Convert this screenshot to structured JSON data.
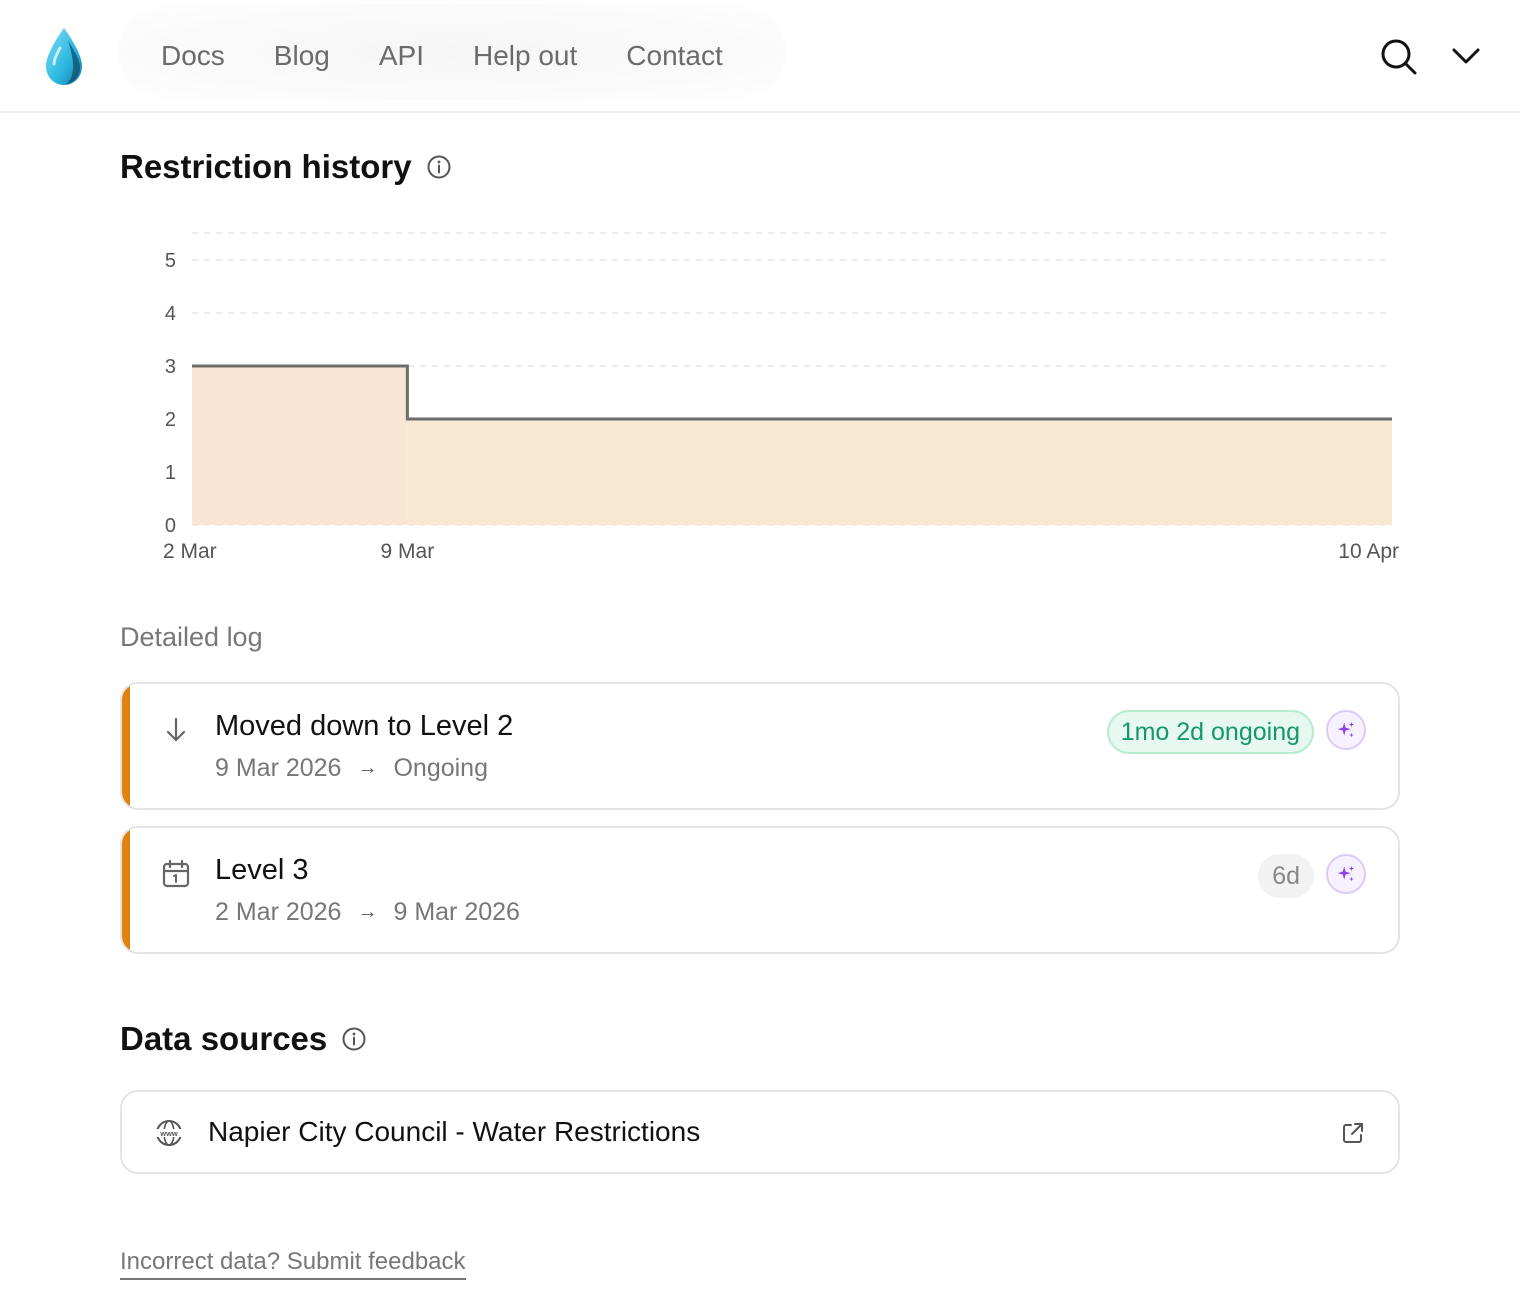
{
  "nav": {
    "items": [
      "Docs",
      "Blog",
      "API",
      "Help out",
      "Contact"
    ]
  },
  "icons": {
    "logo": "water-drop-logo",
    "search": "search-icon",
    "menu": "chevron-down-icon",
    "info": "info-icon",
    "moved_down": "arrow-down-icon",
    "calendar": "calendar-icon",
    "sparkle": "sparkle-icon",
    "globe": "www-globe-icon",
    "external": "external-link-icon"
  },
  "restriction_history": {
    "title": "Restriction history"
  },
  "chart_data": {
    "type": "area",
    "title": "",
    "xlabel": "",
    "ylabel": "",
    "ylim": [
      0,
      5
    ],
    "yticks": [
      "0",
      "1",
      "2",
      "3",
      "4",
      "5"
    ],
    "xticks": [
      "2 Mar",
      "9 Mar",
      "10 Apr"
    ],
    "step": true,
    "grid": true,
    "series": [
      {
        "points": [
          {
            "x": "2 Mar",
            "y": 3
          },
          {
            "x": "9 Mar",
            "y": 2
          },
          {
            "x": "10 Apr",
            "y": 2
          }
        ]
      }
    ],
    "colors": {
      "line": "#6d6d6d",
      "fill_level3": "#f8e5d3",
      "fill_level2": "#f9e8d1"
    }
  },
  "log": {
    "label": "Detailed log",
    "entries": [
      {
        "title": "Moved down to Level 2",
        "start": "9 Mar 2026",
        "end": "Ongoing",
        "badge": "1mo 2d ongoing",
        "badge_style": "green"
      },
      {
        "title": "Level 3",
        "start": "2 Mar 2026",
        "end": "9 Mar 2026",
        "badge": "6d",
        "badge_style": "gray"
      }
    ],
    "arrow": "→"
  },
  "sources": {
    "title": "Data sources",
    "items": [
      {
        "name": "Napier City Council - Water Restrictions"
      }
    ]
  },
  "feedback": {
    "label": "Incorrect data? Submit feedback"
  },
  "colors": {
    "accent": "#e0820e",
    "badge_green_text": "#14996a",
    "ai_purple": "#8a3ff0"
  }
}
